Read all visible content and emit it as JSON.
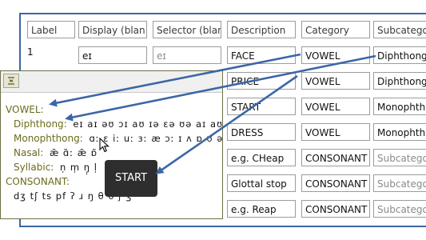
{
  "table": {
    "headers": [
      "Label",
      "Display (blan",
      "Selector (blan",
      "Description",
      "Category",
      "Subcatego"
    ],
    "row_number": "1",
    "rows": [
      {
        "display": "eɪ",
        "selector": "eɪ",
        "description": "FACE",
        "category": "VOWEL",
        "subcategory": "Diphthong"
      },
      {
        "description": "PRICE",
        "category": "VOWEL",
        "subcategory": "Diphthong"
      },
      {
        "description": "START",
        "category": "VOWEL",
        "subcategory": "Monophth"
      },
      {
        "description": "DRESS",
        "category": "VOWEL",
        "subcategory": "Monophth"
      },
      {
        "description": "e.g. CHeap",
        "category": "CONSONANT",
        "subcategory": "Subcatego"
      },
      {
        "description": "Glottal stop",
        "category": "CONSONANT",
        "subcategory": "Subcatego"
      },
      {
        "description": "e.g. Reap",
        "category": "CONSONANT",
        "subcategory": "Subcatego"
      }
    ]
  },
  "popup": {
    "lines": [
      {
        "label": "VOWEL",
        "suffix": ":",
        "symbols": ""
      },
      {
        "label": "Diphthong",
        "suffix": ":",
        "symbols": "eɪ aɪ əʊ ɔɪ aʊ ɪə ɛə ʊə aɪ aʊ"
      },
      {
        "label": "Monophthong",
        "suffix": ":",
        "symbols": "ɑː ɛ iː uː ɜː æ ɔː ɪ ʌ ɒ ʊ ə"
      },
      {
        "label": "Nasal",
        "suffix": ":",
        "symbols": "æ̃ ɑ̃ː æ̃ ɒ̃"
      },
      {
        "label": "Syllabic",
        "suffix": ":",
        "symbols": "n̩ m̩ ŋ̩ l̩"
      },
      {
        "label": "CONSONANT",
        "suffix": ":",
        "symbols": ""
      },
      {
        "label": "",
        "suffix": "",
        "symbols": "dʒ tʃ ts pf ʔ ɹ ŋ θ ð ʃ ʒ"
      }
    ]
  },
  "tooltip": {
    "text": "START"
  },
  "colors": {
    "accent": "#3b67a5",
    "tree_text": "#6b6b1c",
    "tooltip_bg": "#2e2e2e"
  }
}
